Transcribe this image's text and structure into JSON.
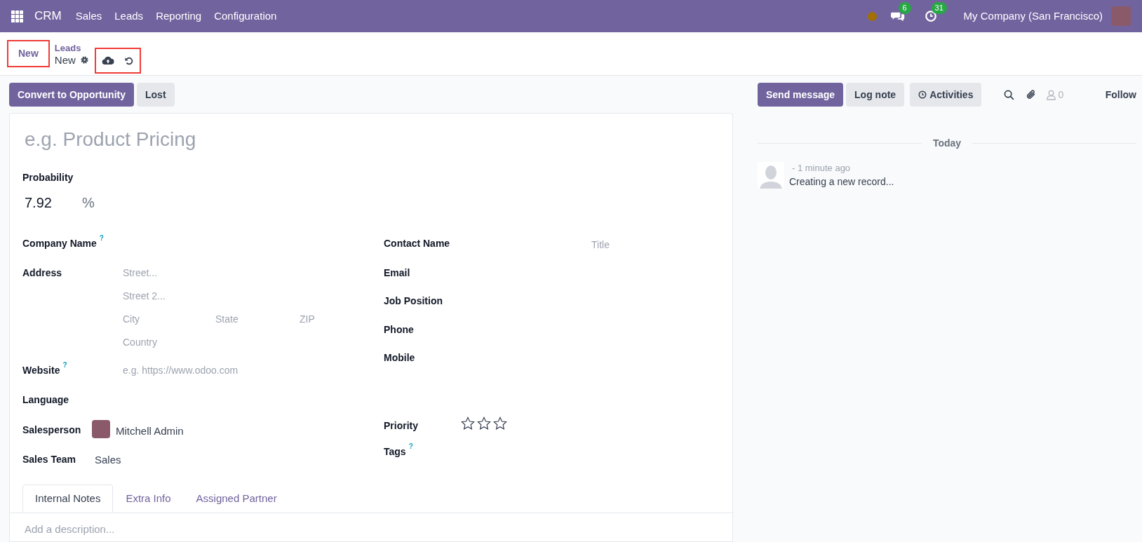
{
  "navbar": {
    "app": "CRM",
    "menu": [
      "Sales",
      "Leads",
      "Reporting",
      "Configuration"
    ],
    "messages_count": "6",
    "activities_count": "31",
    "company": "My Company (San Francisco)"
  },
  "control_panel": {
    "new_button": {
      "label": "New",
      "highlighted": true
    },
    "breadcrumb": "Leads",
    "record": "New",
    "save_discard_highlighted": true
  },
  "status_buttons": [
    "Convert to Opportunity",
    "Lost"
  ],
  "form": {
    "title_placeholder": "e.g. Product Pricing",
    "probability_label": "Probability",
    "probability": "7.92",
    "percent": "%",
    "left": [
      {
        "kind": "plain",
        "label": "Company Name",
        "help": "?"
      },
      {
        "kind": "address",
        "label": "Address",
        "placeholders": [
          "Street...",
          "Street 2...",
          "City",
          "State",
          "ZIP",
          "Country"
        ]
      },
      {
        "kind": "placeholder",
        "label": "Website",
        "help": "?",
        "placeholder": "e.g. https://www.odoo.com"
      },
      {
        "kind": "plain",
        "label": "Language"
      },
      {
        "kind": "user",
        "label": "Salesperson",
        "value": "Mitchell Admin"
      },
      {
        "kind": "value",
        "label": "Sales Team",
        "value": "Sales"
      }
    ],
    "right": [
      {
        "kind": "placeholder",
        "label": "Contact Name",
        "placeholder": "Title"
      },
      {
        "kind": "plain",
        "label": "Email"
      },
      {
        "kind": "plain",
        "label": "Job Position"
      },
      {
        "kind": "plain",
        "label": "Phone"
      },
      {
        "kind": "plain",
        "label": "Mobile"
      },
      {
        "kind": "stars",
        "label": "Priority",
        "stars": 0
      },
      {
        "kind": "plain",
        "label": "Tags",
        "help": "?"
      }
    ],
    "tabs": [
      {
        "label": "Internal Notes",
        "selected": true
      },
      {
        "label": "Extra Info",
        "selected": false
      },
      {
        "label": "Assigned Partner",
        "selected": false
      }
    ],
    "description_placeholder": "Add a description..."
  },
  "chatter": {
    "buttons": [
      "Send message",
      "Log note",
      "Activities"
    ],
    "followers_count": "0",
    "follow": "Follow",
    "separator": "Today",
    "messages": [
      {
        "time": "- 1 minute ago",
        "body": "Creating a new record..."
      }
    ]
  }
}
